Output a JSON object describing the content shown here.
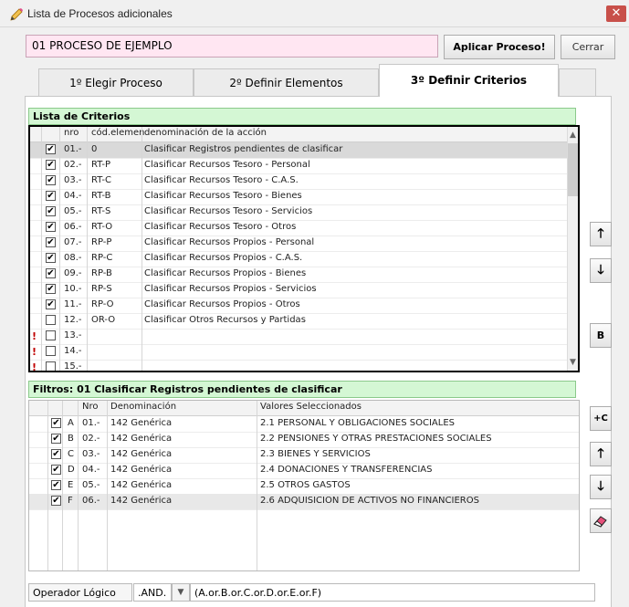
{
  "window": {
    "title": "Lista de Procesos adicionales",
    "close_glyph": "✕"
  },
  "process": {
    "name": "01 PROCESO DE EJEMPLO",
    "apply_label": "Aplicar Proceso!",
    "close_label": "Cerrar"
  },
  "tabs": [
    {
      "label": "1º Elegir Proceso"
    },
    {
      "label": "2º Definir Elementos"
    },
    {
      "label": "3º Definir Criterios"
    }
  ],
  "criteria": {
    "header": "Lista de Criterios",
    "columns": {
      "nro": "nro",
      "code": "cód.elemen",
      "action": "denominación de la acción"
    },
    "rows": [
      {
        "nro": "01.-",
        "code": "0",
        "action": "Clasificar Registros pendientes de clasificar",
        "checked": true
      },
      {
        "nro": "02.-",
        "code": "RT-P",
        "action": "Clasificar Recursos Tesoro - Personal",
        "checked": true
      },
      {
        "nro": "03.-",
        "code": "RT-C",
        "action": "Clasificar Recursos Tesoro - C.A.S.",
        "checked": true
      },
      {
        "nro": "04.-",
        "code": "RT-B",
        "action": "Clasificar Recursos Tesoro - Bienes",
        "checked": true
      },
      {
        "nro": "05.-",
        "code": "RT-S",
        "action": "Clasificar Recursos Tesoro - Servicios",
        "checked": true
      },
      {
        "nro": "06.-",
        "code": "RT-O",
        "action": "Clasificar Recursos Tesoro - Otros",
        "checked": true
      },
      {
        "nro": "07.-",
        "code": "RP-P",
        "action": "Clasificar Recursos Propios - Personal",
        "checked": true
      },
      {
        "nro": "08.-",
        "code": "RP-C",
        "action": "Clasificar Recursos Propios - C.A.S.",
        "checked": true
      },
      {
        "nro": "09.-",
        "code": "RP-B",
        "action": "Clasificar Recursos Propios - Bienes",
        "checked": true
      },
      {
        "nro": "10.-",
        "code": "RP-S",
        "action": "Clasificar Recursos Propios - Servicios",
        "checked": true
      },
      {
        "nro": "11.-",
        "code": "RP-O",
        "action": "Clasificar Recursos Propios - Otros",
        "checked": true
      },
      {
        "nro": "12.-",
        "code": "OR-O",
        "action": "Clasificar Otros Recursos y Partidas",
        "checked": false
      },
      {
        "nro": "13.-",
        "code": "",
        "action": "",
        "checked": false,
        "warning": "!"
      },
      {
        "nro": "14.-",
        "code": "",
        "action": "",
        "checked": false,
        "warning": "!"
      },
      {
        "nro": "15.-",
        "code": "",
        "action": "",
        "checked": false,
        "warning": "!"
      }
    ]
  },
  "side_buttons": {
    "up": "🡑",
    "down": "🡓",
    "b": "B",
    "plus_c": "+C"
  },
  "filters": {
    "header": "Filtros: 01 Clasificar Registros pendientes de clasificar",
    "columns": {
      "nro": "Nro",
      "name": "Denominación",
      "values": "Valores Seleccionados"
    },
    "rows": [
      {
        "letter": "A",
        "nro": "01.-",
        "name": "142 Genérica",
        "values": "2.1 PERSONAL Y OBLIGACIONES SOCIALES",
        "checked": true
      },
      {
        "letter": "B",
        "nro": "02.-",
        "name": "142 Genérica",
        "values": "2.2 PENSIONES Y OTRAS PRESTACIONES SOCIALES",
        "checked": true
      },
      {
        "letter": "C",
        "nro": "03.-",
        "name": "142 Genérica",
        "values": "2.3 BIENES Y SERVICIOS",
        "checked": true
      },
      {
        "letter": "D",
        "nro": "04.-",
        "name": "142 Genérica",
        "values": "2.4 DONACIONES Y TRANSFERENCIAS",
        "checked": true
      },
      {
        "letter": "E",
        "nro": "05.-",
        "name": "142 Genérica",
        "values": "2.5 OTROS GASTOS",
        "checked": true
      },
      {
        "letter": "F",
        "nro": "06.-",
        "name": "142 Genérica",
        "values": "2.6 ADQUISICION DE ACTIVOS NO FINANCIEROS",
        "checked": true
      }
    ]
  },
  "operator": {
    "label": "Operador Lógico",
    "value": ".AND.",
    "expression": "(A.or.B.or.C.or.D.or.E.or.F)"
  },
  "colors": {
    "process_bg": "#ffe6f2",
    "section_header_bg": "#d4f7d4",
    "close_red": "#c8504a",
    "warning": "#c00000"
  }
}
